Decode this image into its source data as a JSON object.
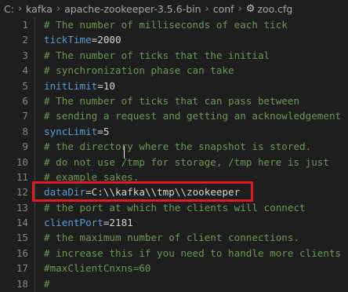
{
  "breadcrumb": {
    "items": [
      "C:",
      "kafka",
      "apache-zookeeper-3.5.6-bin",
      "conf",
      "zoo.cfg"
    ],
    "separator": "›",
    "file_icon": "gear-icon"
  },
  "editor": {
    "lines": [
      {
        "num": "1",
        "comment": "# The number of milliseconds of each tick"
      },
      {
        "num": "2",
        "key": "tickTime",
        "eq": "=",
        "value": "2000"
      },
      {
        "num": "3",
        "comment": "# The number of ticks that the initial"
      },
      {
        "num": "4",
        "comment": "# synchronization phase can take"
      },
      {
        "num": "5",
        "key": "initLimit",
        "eq": "=",
        "value": "10"
      },
      {
        "num": "6",
        "comment": "# The number of ticks that can pass between"
      },
      {
        "num": "7",
        "comment": "# sending a request and getting an acknowledgement"
      },
      {
        "num": "8",
        "key": "syncLimit",
        "eq": "=",
        "value": "5"
      },
      {
        "num": "9",
        "comment": "# the directory where the snapshot is stored."
      },
      {
        "num": "10",
        "comment": "# do not use /tmp for storage, /tmp here is just"
      },
      {
        "num": "11",
        "comment": "# example sakes."
      },
      {
        "num": "12",
        "key": "dataDir",
        "eq": "=",
        "value": "C:\\\\kafka\\\\tmp\\\\zookeeper"
      },
      {
        "num": "13",
        "comment": "# the port at which the clients will connect"
      },
      {
        "num": "14",
        "key": "clientPort",
        "eq": "=",
        "value": "2181"
      },
      {
        "num": "15",
        "comment": "# the maximum number of client connections."
      },
      {
        "num": "16",
        "comment": "# increase this if you need to handle more clients"
      },
      {
        "num": "17",
        "comment": "#maxClientCnxns=60"
      },
      {
        "num": "18",
        "comment": "#"
      },
      {
        "num": "19",
        "comment": "# Be sure to read the maintenance section of the"
      }
    ]
  },
  "colors": {
    "background": "#1e1e1e",
    "comment": "#6a9955",
    "key": "#569cd6",
    "line_number": "#858585",
    "highlight_border": "#e01b24"
  }
}
